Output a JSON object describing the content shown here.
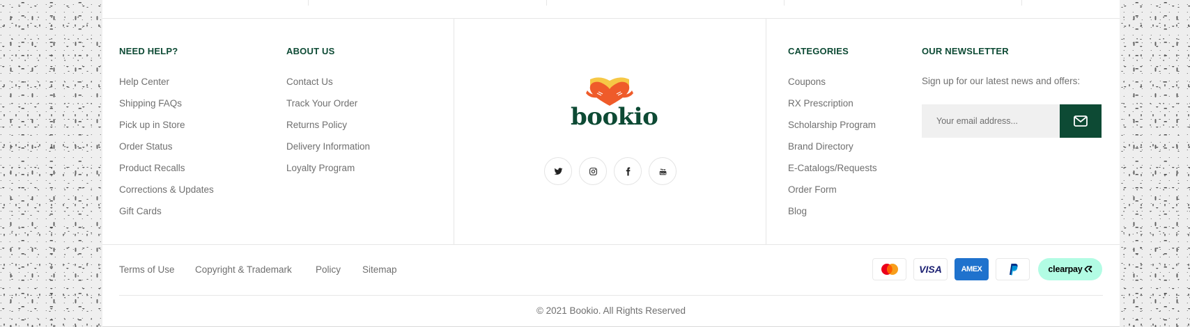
{
  "need_help": {
    "heading": "NEED HELP?",
    "links": [
      "Help Center",
      "Shipping FAQs",
      "Pick up in Store",
      "Order Status",
      "Product Recalls",
      "Corrections & Updates",
      "Gift Cards"
    ]
  },
  "about_us": {
    "heading": "ABOUT US",
    "links": [
      "Contact Us",
      "Track Your Order",
      "Returns Policy",
      "Delivery Information",
      "Loyalty Program"
    ]
  },
  "brand": {
    "logo_text": "bookio",
    "social_icons": [
      "twitter-icon",
      "instagram-icon",
      "facebook-icon",
      "youtube-icon"
    ]
  },
  "categories": {
    "heading": "CATEGORIES",
    "links": [
      "Coupons",
      "RX Prescription",
      "Scholarship Program",
      "Brand Directory",
      "E-Catalogs/Requests",
      "Order Form",
      "Blog"
    ]
  },
  "newsletter": {
    "heading": "OUR NEWSLETTER",
    "text": "Sign up for our latest news and offers:",
    "placeholder": "Your email address...",
    "submit_icon": "envelope-icon"
  },
  "legal_links": [
    "Terms of Use",
    "Copyright & Trademark",
    "Policy",
    "Sitemap"
  ],
  "payments": {
    "visa": "VISA",
    "amex": "AMEX",
    "clearpay": "clearpay"
  },
  "copyright": "© 2021 Bookio. All Rights Reserved",
  "colors": {
    "brand_green": "#0d4a34",
    "logo_orange": "#ef5b2a",
    "logo_yellow": "#f6c846",
    "clearpay_mint": "#b2fce4",
    "amex_blue": "#1f72cd"
  }
}
